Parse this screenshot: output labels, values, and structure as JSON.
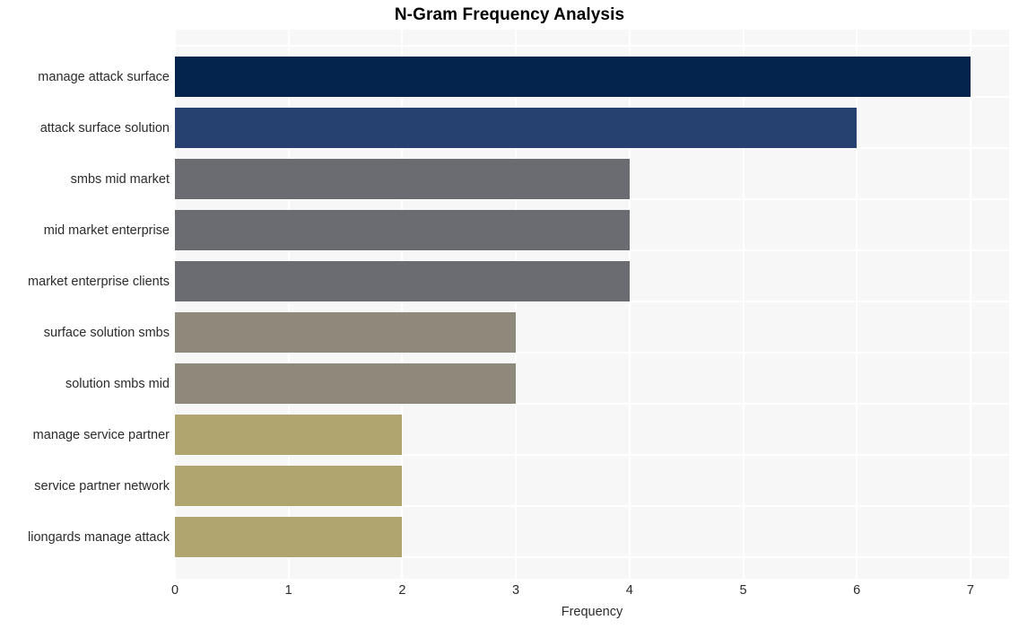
{
  "chart_data": {
    "type": "bar",
    "orientation": "horizontal",
    "title": "N-Gram Frequency Analysis",
    "xlabel": "Frequency",
    "ylabel": "",
    "xlim": [
      0,
      7.34
    ],
    "xticks": [
      0,
      1,
      2,
      3,
      4,
      5,
      6,
      7
    ],
    "xticklabels": [
      "0",
      "1",
      "2",
      "3",
      "4",
      "5",
      "6",
      "7"
    ],
    "grid": true,
    "grid_color": "#ffffff",
    "plot_background": "#f7f7f8",
    "figure_background": "#ffffff",
    "legend": null,
    "categories": [
      "manage attack surface",
      "attack surface solution",
      "smbs mid market",
      "mid market enterprise",
      "market enterprise clients",
      "surface solution smbs",
      "solution smbs mid",
      "manage service partner",
      "service partner network",
      "liongards manage attack"
    ],
    "values": [
      7,
      6,
      4,
      4,
      4,
      3,
      3,
      2,
      2,
      2
    ],
    "bar_colors": [
      "#04234d",
      "#26406f",
      "#6b6c71",
      "#6b6c71",
      "#6b6c71",
      "#8e897b",
      "#8e897b",
      "#b0a56e",
      "#b0a56e",
      "#b0a56e"
    ],
    "bars": [
      {
        "label": "manage attack surface",
        "value": 7,
        "color": "#04234d"
      },
      {
        "label": "attack surface solution",
        "value": 6,
        "color": "#26406f"
      },
      {
        "label": "smbs mid market",
        "value": 4,
        "color": "#6b6c71"
      },
      {
        "label": "mid market enterprise",
        "value": 4,
        "color": "#6b6c71"
      },
      {
        "label": "market enterprise clients",
        "value": 4,
        "color": "#6b6c71"
      },
      {
        "label": "surface solution smbs",
        "value": 3,
        "color": "#8e897b"
      },
      {
        "label": "solution smbs mid",
        "value": 3,
        "color": "#8e897b"
      },
      {
        "label": "manage service partner",
        "value": 2,
        "color": "#b0a56e"
      },
      {
        "label": "service partner network",
        "value": 2,
        "color": "#b0a56e"
      },
      {
        "label": "liongards manage attack",
        "value": 2,
        "color": "#b0a56e"
      }
    ]
  }
}
